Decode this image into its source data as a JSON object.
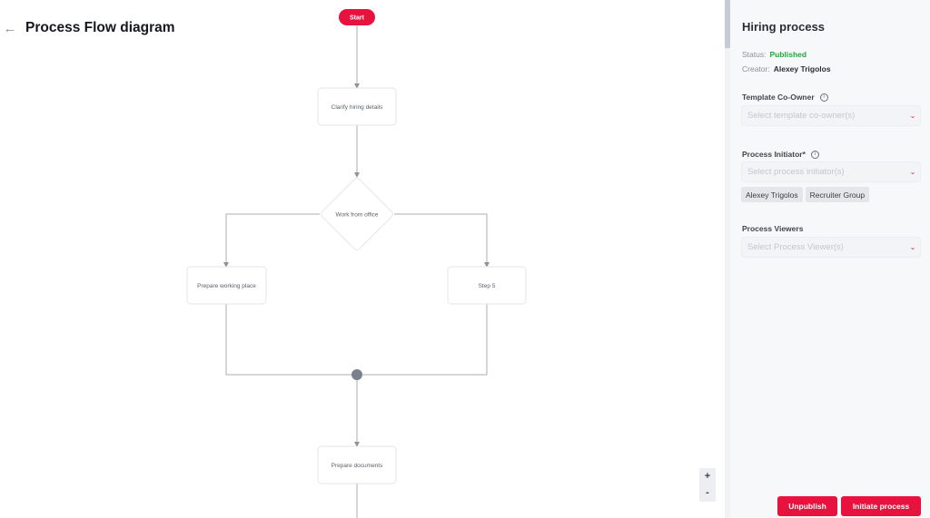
{
  "header": {
    "back_icon": "arrow-left-icon",
    "title": "Process Flow diagram"
  },
  "flow": {
    "nodes": [
      {
        "id": "start",
        "type": "terminator",
        "label": "Start"
      },
      {
        "id": "clarify",
        "type": "process",
        "label": "Clarify hiring details"
      },
      {
        "id": "work-from-office",
        "type": "decision",
        "label": "Work from office"
      },
      {
        "id": "prepare-working-place",
        "type": "process",
        "label": "Prepare working place"
      },
      {
        "id": "step-5",
        "type": "process",
        "label": "Step 5"
      },
      {
        "id": "merge",
        "type": "junction",
        "label": ""
      },
      {
        "id": "prepare-documents",
        "type": "process",
        "label": "Prepare documents"
      }
    ],
    "edges": [
      {
        "from": "start",
        "to": "clarify"
      },
      {
        "from": "clarify",
        "to": "work-from-office"
      },
      {
        "from": "work-from-office",
        "to": "prepare-working-place"
      },
      {
        "from": "work-from-office",
        "to": "step-5"
      },
      {
        "from": "prepare-working-place",
        "to": "merge"
      },
      {
        "from": "step-5",
        "to": "merge"
      },
      {
        "from": "merge",
        "to": "prepare-documents"
      }
    ],
    "colors": {
      "start_fill": "#e8123f",
      "edge": "#a9adb3",
      "node_border": "#e3e5e8",
      "junction": "#7b818c"
    }
  },
  "zoom_controls": {
    "zoom_in": "+",
    "zoom_out": "-"
  },
  "panel": {
    "title": "Hiring process",
    "status_label": "Status:",
    "status_value": "Published",
    "creator_label": "Creator:",
    "creator_value": "Alexey Trigolos",
    "co_owner": {
      "label": "Template Co-Owner",
      "placeholder": "Select template co-owner(s)"
    },
    "initiator": {
      "label": "Process Initiator*",
      "placeholder": "Select process initiator(s)",
      "selected": [
        "Alexey Trigolos",
        "Recruiter Group"
      ]
    },
    "viewers": {
      "label": "Process Viewers",
      "placeholder": "Select Process Viewer(s)"
    },
    "buttons": {
      "unpublish": "Unpublish",
      "initiate": "Initiate process"
    },
    "colors": {
      "accent": "#e8123f",
      "published": "#22a83a"
    }
  }
}
